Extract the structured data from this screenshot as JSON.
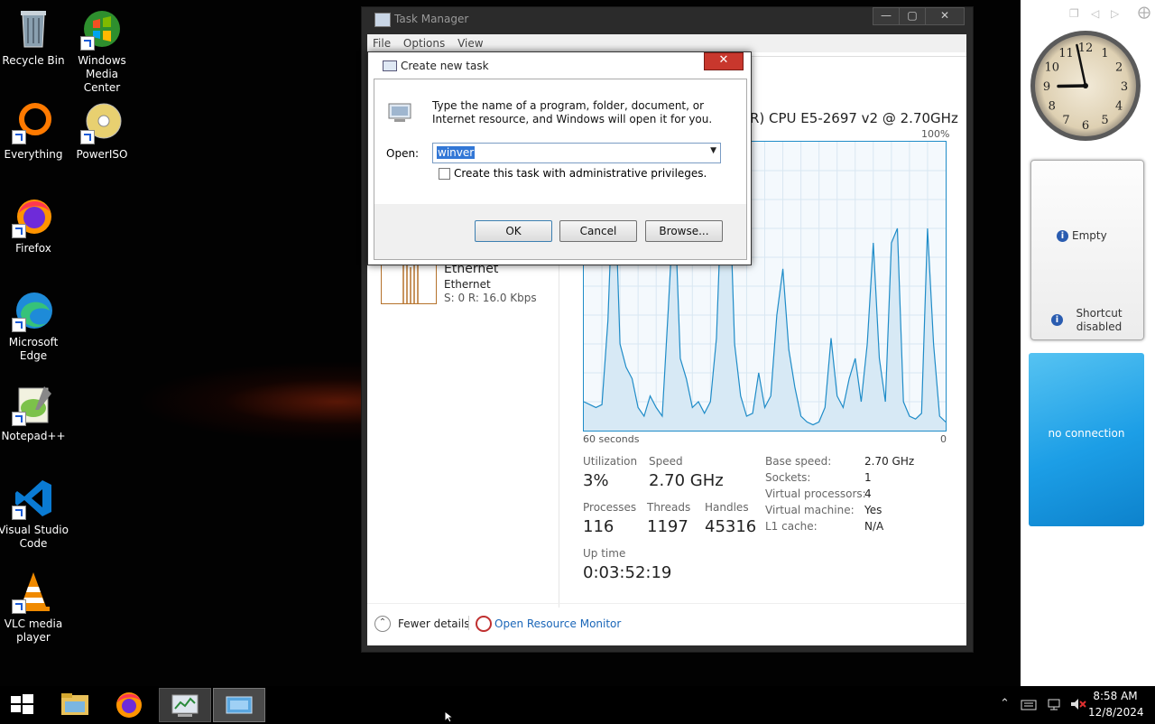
{
  "desktop_icons": [
    {
      "label": "Recycle Bin",
      "icon": "recycle-bin-icon"
    },
    {
      "label": "Windows Media Center",
      "icon": "windows-media-center-icon"
    },
    {
      "label": "Everything",
      "icon": "everything-icon"
    },
    {
      "label": "PowerISO",
      "icon": "poweriso-icon"
    },
    {
      "label": "Firefox",
      "icon": "firefox-icon"
    },
    {
      "label": "Microsoft Edge",
      "icon": "edge-icon"
    },
    {
      "label": "Notepad++",
      "icon": "notepadpp-icon"
    },
    {
      "label": "Visual Studio Code",
      "icon": "vscode-icon"
    },
    {
      "label": "VLC media player",
      "icon": "vlc-icon"
    }
  ],
  "task_manager": {
    "title": "Task Manager",
    "menu": [
      "File",
      "Options",
      "View"
    ],
    "cpu_name": "R) CPU E5-2697 v2 @ 2.70GHz",
    "graph_max_label": "100%",
    "graph_time_label": "60 seconds",
    "graph_min_label": "0",
    "ethernet": {
      "title": "Ethernet",
      "subtitle": "Ethernet",
      "rate": "S: 0 R: 16.0 Kbps"
    },
    "stats": {
      "utilization_label": "Utilization",
      "utilization": "3%",
      "speed_label": "Speed",
      "speed": "2.70 GHz",
      "processes_label": "Processes",
      "processes": "116",
      "threads_label": "Threads",
      "threads": "1197",
      "handles_label": "Handles",
      "handles": "45316",
      "uptime_label": "Up time",
      "uptime": "0:03:52:19"
    },
    "details": [
      {
        "key": "Base speed:",
        "value": "2.70 GHz"
      },
      {
        "key": "Sockets:",
        "value": "1"
      },
      {
        "key": "Virtual processors:",
        "value": "4"
      },
      {
        "key": "Virtual machine:",
        "value": "Yes"
      },
      {
        "key": "L1 cache:",
        "value": "N/A"
      }
    ],
    "fewer_details": "Fewer details",
    "resource_monitor": "Open Resource Monitor",
    "cpu_history": [
      10,
      9,
      8,
      9,
      38,
      95,
      30,
      22,
      18,
      8,
      5,
      12,
      8,
      5,
      42,
      82,
      25,
      18,
      8,
      10,
      6,
      10,
      32,
      90,
      95,
      30,
      12,
      5,
      6,
      20,
      8,
      12,
      40,
      56,
      28,
      15,
      5,
      3,
      2,
      3,
      8,
      32,
      12,
      8,
      18,
      25,
      10,
      30,
      65,
      25,
      10,
      65,
      70,
      10,
      5,
      4,
      6,
      70,
      30,
      5,
      3
    ]
  },
  "dialog": {
    "title": "Create new task",
    "description": "Type the name of a program, folder, document, or Internet resource, and Windows will open it for you.",
    "open_label": "Open:",
    "open_value": "winver",
    "admin_checkbox_label": "Create this task with administrative privileges.",
    "admin_checked": false,
    "ok": "OK",
    "cancel": "Cancel",
    "browse": "Browse..."
  },
  "sidebar": {
    "clock": {
      "hour": 8,
      "minute": 58
    },
    "clock_numbers": [
      "12",
      "1",
      "2",
      "3",
      "4",
      "5",
      "6",
      "7",
      "8",
      "9",
      "10",
      "11"
    ],
    "gadget1_line1": "Empty",
    "gadget1_line2": "Shortcut disabled",
    "gadget2_text": "no connection",
    "gadget2_color": "#1c9ee6"
  },
  "taskbar": {
    "apps": [
      "start-icon",
      "file-explorer-icon",
      "firefox-icon",
      "task-manager-icon",
      "run-dialog-icon"
    ],
    "time": "8:58 AM",
    "date": "12/8/2024"
  }
}
